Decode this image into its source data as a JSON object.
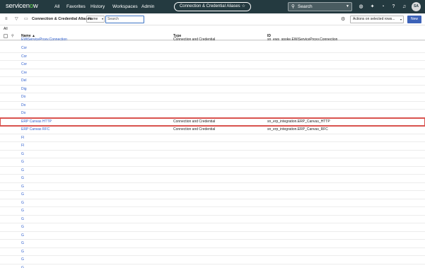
{
  "topnav": {
    "logo_prefix": "servicen",
    "logo_o": "o",
    "logo_suffix": "w",
    "links": [
      "All",
      "Favorites",
      "History",
      "Workspaces",
      "Admin"
    ],
    "context_pill": "Connection & Credential Aliases",
    "global_search_placeholder": "Search",
    "avatar_initials": "SA"
  },
  "listbar": {
    "title": "Connection & Credential Aliases",
    "field_select": "Name",
    "search_placeholder": "Search",
    "actions_select": "Actions on selected rows...",
    "new_button": "New"
  },
  "breadcrumb": "All",
  "columns": {
    "name": "Name",
    "type": "Type",
    "id": "ID"
  },
  "rows": [
    {
      "name": "EWiServiceProxy.Connection",
      "type": "Connection and Credential",
      "id": "sn_ews_spoke.EWiServiceProxy.Connection"
    },
    {
      "name": "Cor",
      "type": "",
      "id": ""
    },
    {
      "name": "Cor",
      "type": "",
      "id": ""
    },
    {
      "name": "Cor",
      "type": "",
      "id": ""
    },
    {
      "name": "Cre",
      "type": "",
      "id": ""
    },
    {
      "name": "Del",
      "type": "",
      "id": ""
    },
    {
      "name": "Dig",
      "type": "",
      "id": ""
    },
    {
      "name": "Do",
      "type": "",
      "id": ""
    },
    {
      "name": "Do",
      "type": "",
      "id": ""
    },
    {
      "name": "Do",
      "type": "",
      "id": ""
    },
    {
      "name": "ERP Canvas HTTP",
      "type": "Connection and Credential",
      "id": "sn_erp_integration.ERP_Canvas_HTTP"
    },
    {
      "name": "ERP Canvas RFC",
      "type": "Connection and Credential",
      "id": "sn_erp_integration.ERP_Canvas_RFC"
    },
    {
      "name": "Fl",
      "type": "",
      "id": ""
    },
    {
      "name": "Fl",
      "type": "",
      "id": ""
    },
    {
      "name": "G",
      "type": "",
      "id": ""
    },
    {
      "name": "G",
      "type": "",
      "id": ""
    },
    {
      "name": "G",
      "type": "",
      "id": ""
    },
    {
      "name": "G",
      "type": "",
      "id": ""
    },
    {
      "name": "G",
      "type": "",
      "id": ""
    },
    {
      "name": "G",
      "type": "",
      "id": ""
    },
    {
      "name": "G",
      "type": "",
      "id": ""
    },
    {
      "name": "G",
      "type": "",
      "id": ""
    },
    {
      "name": "G",
      "type": "",
      "id": ""
    },
    {
      "name": "G",
      "type": "",
      "id": ""
    },
    {
      "name": "G",
      "type": "",
      "id": ""
    },
    {
      "name": "G",
      "type": "",
      "id": ""
    },
    {
      "name": "G",
      "type": "",
      "id": ""
    },
    {
      "name": "G",
      "type": "",
      "id": ""
    },
    {
      "name": "G",
      "type": "",
      "id": ""
    }
  ],
  "highlighted_row_name": "ERP Canvas HTTP",
  "colors": {
    "nav_bg": "#243a40",
    "link": "#2f5fce",
    "highlight": "#d9534f",
    "primary_button": "#3c62b8",
    "logo_accent": "#62d84e"
  }
}
